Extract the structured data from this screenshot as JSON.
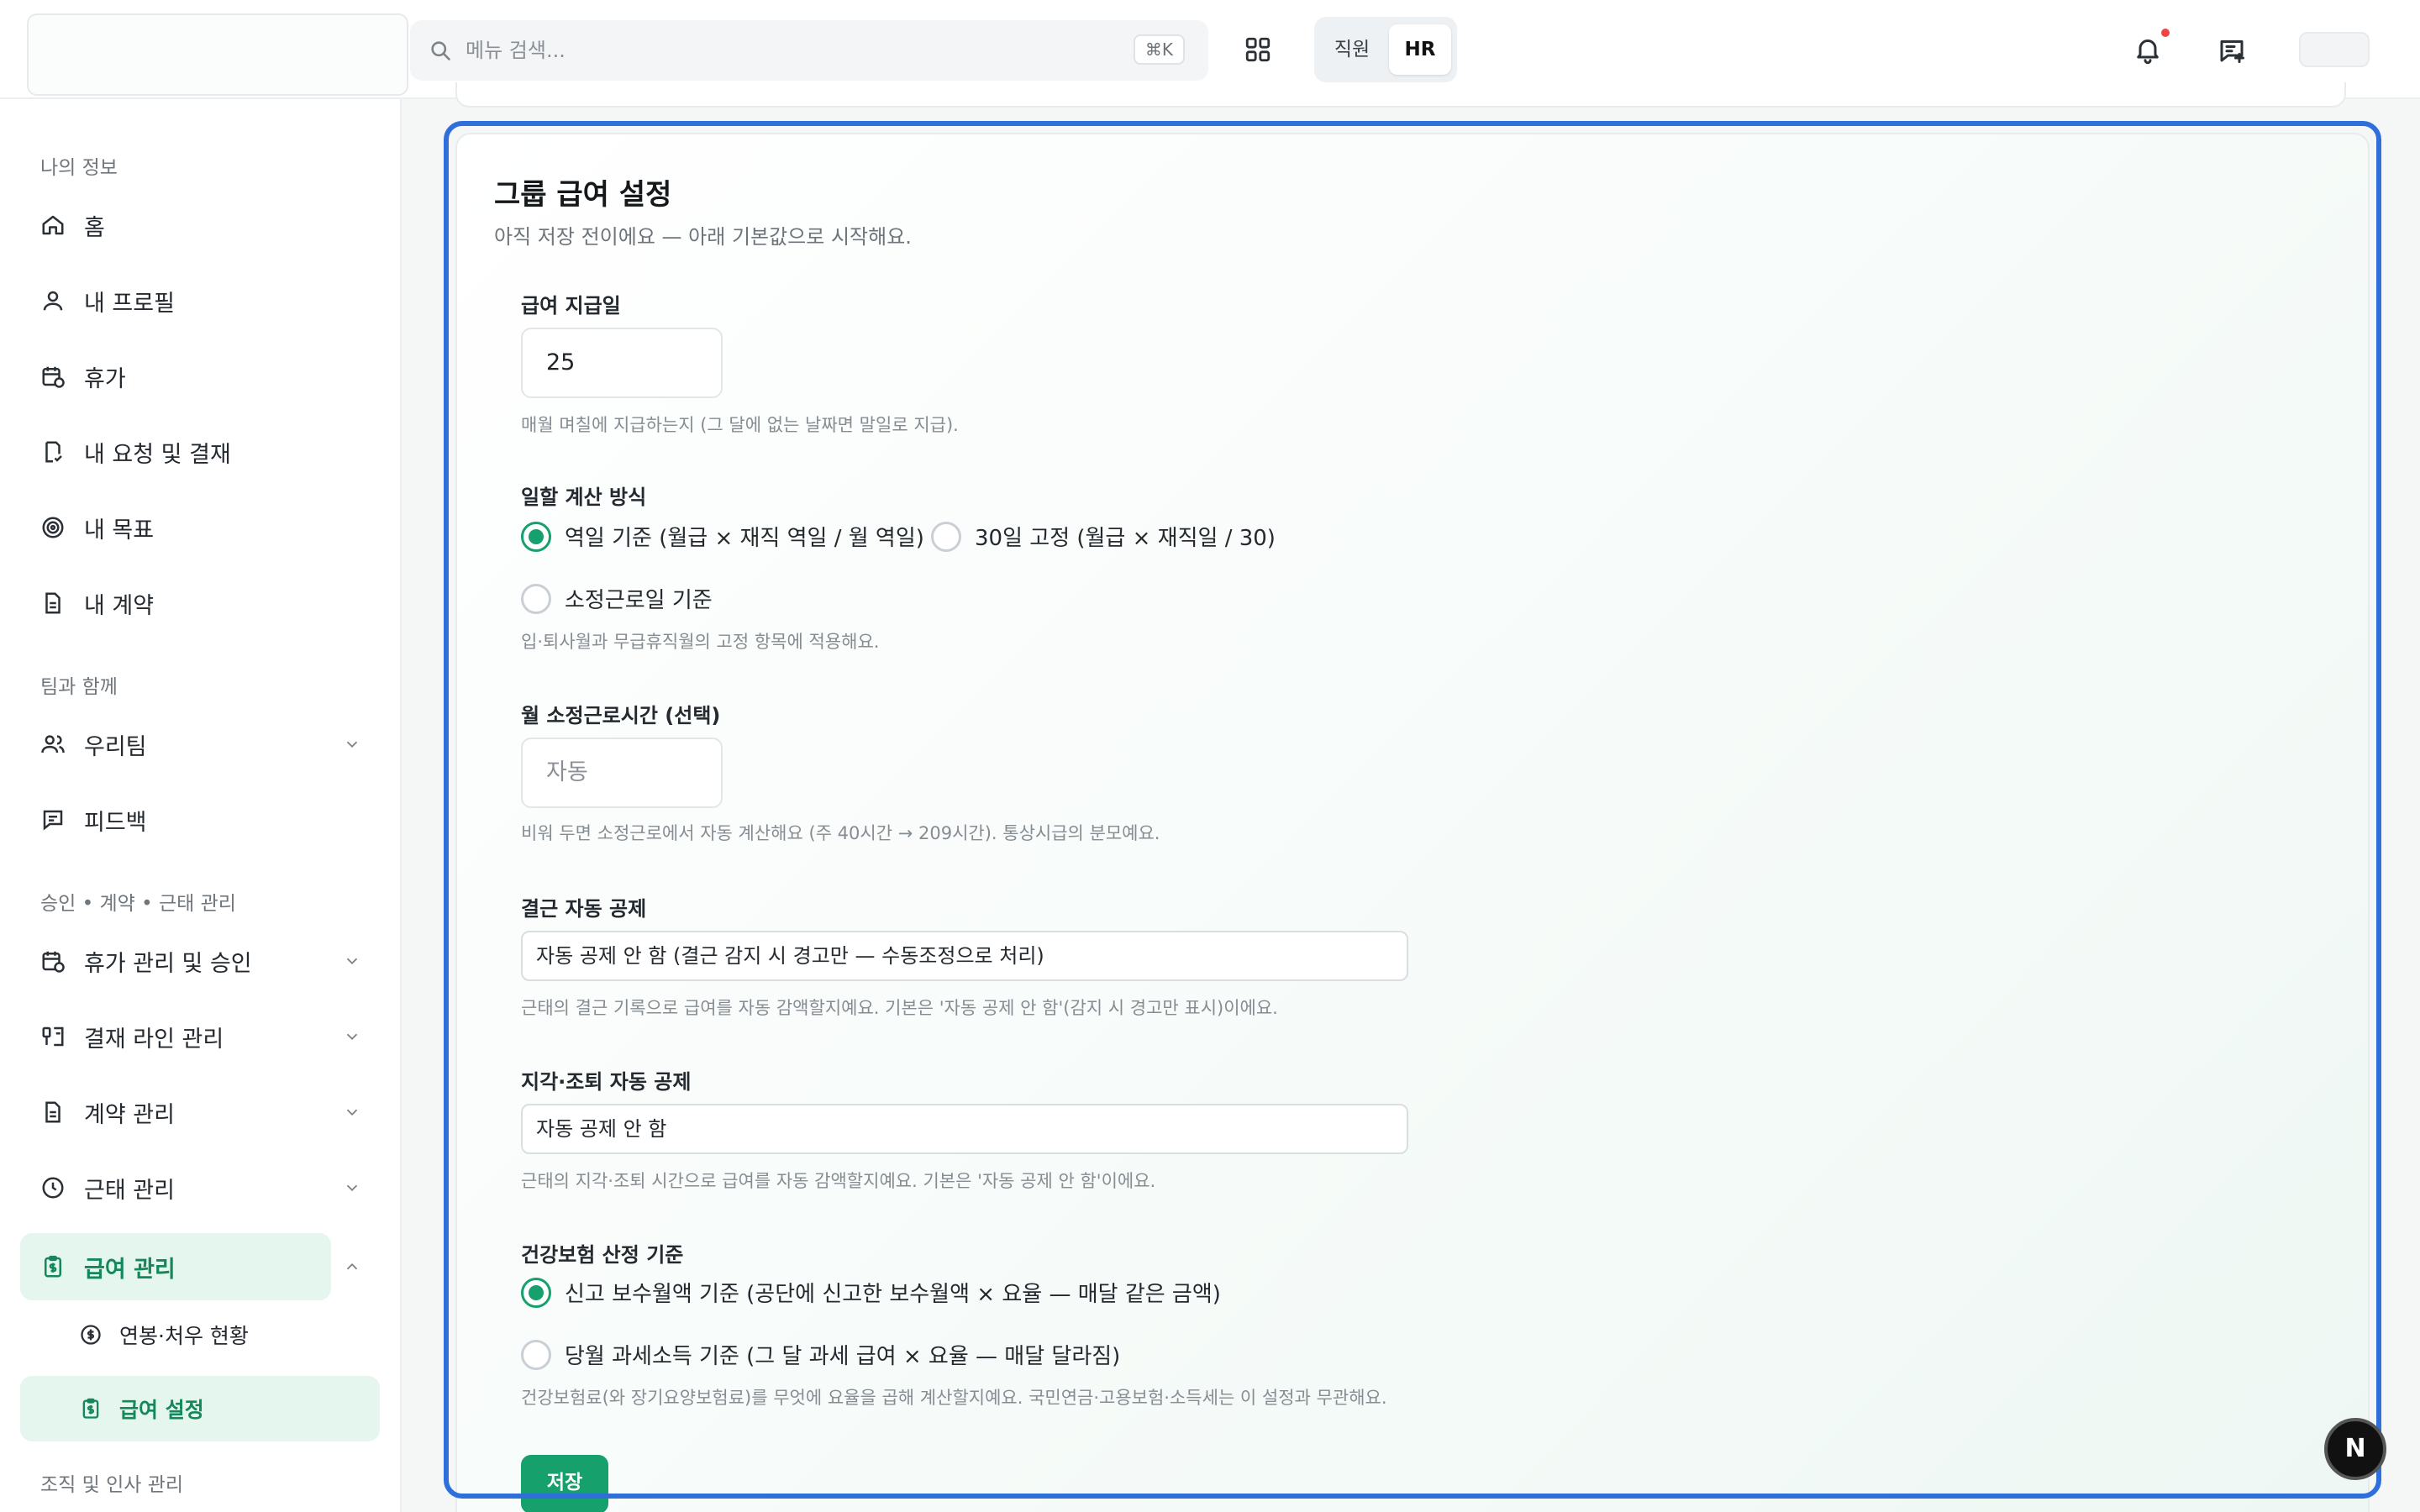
{
  "header": {
    "search_placeholder": "메뉴 검색...",
    "search_shortcut": "⌘K",
    "role_staff": "직원",
    "role_hr": "HR",
    "notification_dot_color": "#ef4444"
  },
  "sidebar": {
    "sections": {
      "my_info": "나의 정보",
      "with_team": "팀과 함께",
      "approval": "승인 • 계약 • 근태 관리",
      "org": "조직 및 인사 관리"
    },
    "items": {
      "home": "홈",
      "profile": "내 프로필",
      "leave": "휴가",
      "requests": "내 요청 및 결재",
      "goals": "내 목표",
      "contracts": "내 계약",
      "our_team": "우리팀",
      "feedback": "피드백",
      "leave_mgmt": "휴가 관리 및 승인",
      "approval_line": "결재 라인 관리",
      "contract_mgmt": "계약 관리",
      "attendance_mgmt": "근태 관리",
      "payroll_mgmt": "급여 관리",
      "salary_status": "연봉·처우 현황",
      "payroll_settings": "급여 설정"
    },
    "accent_color": "#14875b"
  },
  "card": {
    "title": "그룹 급여 설정",
    "subtitle": "아직 저장 전이에요 — 아래 기본값으로 시작해요.",
    "pay_day": {
      "label": "급여 지급일",
      "value": "25",
      "help": "매월 며칠에 지급하는지 (그 달에 없는 날짜면 말일로 지급)."
    },
    "prorate": {
      "label": "일할 계산 방식",
      "options": [
        "역일 기준 (월급 × 재직 역일 / 월 역일)",
        "30일 고정 (월급 × 재직일 / 30)",
        "소정근로일 기준"
      ],
      "selected_index": 0,
      "help": "입·퇴사월과 무급휴직월의 고정 항목에 적용해요."
    },
    "monthly_hours": {
      "label": "월 소정근로시간 (선택)",
      "placeholder": "자동",
      "help": "비워 두면 소정근로에서 자동 계산해요 (주 40시간 → 209시간). 통상시급의 분모예요."
    },
    "absence_deduction": {
      "label": "결근 자동 공제",
      "value": "자동 공제 안 함 (결근 감지 시 경고만 — 수동조정으로 처리)",
      "help": "근태의 결근 기록으로 급여를 자동 감액할지예요. 기본은 '자동 공제 안 함'(감지 시 경고만 표시)이에요."
    },
    "late_deduction": {
      "label": "지각·조퇴 자동 공제",
      "value": "자동 공제 안 함",
      "help": "근태의 지각·조퇴 시간으로 급여를 자동 감액할지예요. 기본은 '자동 공제 안 함'이에요."
    },
    "health_insurance": {
      "label": "건강보험 산정 기준",
      "options": [
        "신고 보수월액 기준 (공단에 신고한 보수월액 × 요율 — 매달 같은 금액)",
        "당월 과세소득 기준 (그 달 과세 급여 × 요율 — 매달 달라짐)"
      ],
      "selected_index": 0,
      "help": "건강보험료(와 장기요양보험료)를 무엇에 요율을 곱해 계산할지예요. 국민연금·고용보험·소득세는 이 설정과 무관해요."
    },
    "save_label": "저장",
    "accent_color": "#16a06b",
    "focus_ring_color": "#2f6fdc"
  },
  "floating_badge": "N"
}
